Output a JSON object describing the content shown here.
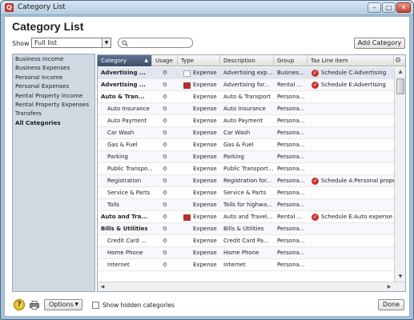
{
  "window": {
    "title": "Category List",
    "app_icon": "Q",
    "controls": {
      "minimize": "–",
      "maximize": "□",
      "close": "✕"
    }
  },
  "page": {
    "heading": "Category List"
  },
  "toolbar": {
    "show_label": "Show",
    "show_value": "Full list",
    "search_placeholder": "",
    "add_category_label": "Add Category"
  },
  "sidebar": {
    "items": [
      {
        "label": "Business Income",
        "selected": false
      },
      {
        "label": "Business Expenses",
        "selected": false
      },
      {
        "label": "Personal Income",
        "selected": false
      },
      {
        "label": "Personal Expenses",
        "selected": false
      },
      {
        "label": "Rental Property Income",
        "selected": false
      },
      {
        "label": "Rental Property Expenses",
        "selected": false
      },
      {
        "label": "Transfers",
        "selected": false
      },
      {
        "label": "All Categories",
        "selected": true
      }
    ]
  },
  "table": {
    "columns": [
      "Category",
      "Usage",
      "Type",
      "Description",
      "Group",
      "Tax Line Item"
    ],
    "sorted_column": "Category",
    "rows": [
      {
        "category": "Advertising ...",
        "usage": "0",
        "type": "Expense",
        "type_icon": "plain",
        "description": "Advertising exp...",
        "group": "Busines...",
        "tax": "Schedule C:Advertising",
        "bold": true,
        "selected": true
      },
      {
        "category": "Advertising ...",
        "usage": "0",
        "type": "Expense",
        "type_icon": "house",
        "description": "Advertising for...",
        "group": "Rental ...",
        "tax": "Schedule E:Advertising",
        "bold": true
      },
      {
        "category": "Auto & Tran...",
        "usage": "0",
        "type": "Expense",
        "type_icon": "",
        "description": "Auto & Transport",
        "group": "Persona...",
        "tax": "",
        "bold": true
      },
      {
        "category": "Auto Insurance",
        "usage": "0",
        "type": "Expense",
        "type_icon": "",
        "description": "Auto Insurance",
        "group": "Persona...",
        "tax": "",
        "indent": true
      },
      {
        "category": "Auto Payment",
        "usage": "0",
        "type": "Expense",
        "type_icon": "",
        "description": "Auto Payment",
        "group": "Persona...",
        "tax": "",
        "indent": true
      },
      {
        "category": "Car Wash",
        "usage": "0",
        "type": "Expense",
        "type_icon": "",
        "description": "Car Wash",
        "group": "Persona...",
        "tax": "",
        "indent": true
      },
      {
        "category": "Gas & Fuel",
        "usage": "0",
        "type": "Expense",
        "type_icon": "",
        "description": "Gas & Fuel",
        "group": "Persona...",
        "tax": "",
        "indent": true
      },
      {
        "category": "Parking",
        "usage": "0",
        "type": "Expense",
        "type_icon": "",
        "description": "Parking",
        "group": "Persona...",
        "tax": "",
        "indent": true
      },
      {
        "category": "Public Transpo...",
        "usage": "0",
        "type": "Expense",
        "type_icon": "",
        "description": "Public Transport...",
        "group": "Persona...",
        "tax": "",
        "indent": true
      },
      {
        "category": "Registration",
        "usage": "0",
        "type": "Expense",
        "type_icon": "",
        "description": "Registration for...",
        "group": "Persona...",
        "tax": "Schedule A:Personal property...",
        "indent": true
      },
      {
        "category": "Service & Parts",
        "usage": "0",
        "type": "Expense",
        "type_icon": "",
        "description": "Service & Parts",
        "group": "Persona...",
        "tax": "",
        "indent": true
      },
      {
        "category": "Tolls",
        "usage": "0",
        "type": "Expense",
        "type_icon": "",
        "description": "Tolls for highwa...",
        "group": "Persona...",
        "tax": "",
        "indent": true
      },
      {
        "category": "Auto and Tra...",
        "usage": "0",
        "type": "Expense",
        "type_icon": "house",
        "description": "Auto and Travel...",
        "group": "Rental ...",
        "tax": "Schedule E:Auto expense",
        "bold": true
      },
      {
        "category": "Bills & Utilities",
        "usage": "0",
        "type": "Expense",
        "type_icon": "",
        "description": "Bills & Utilities",
        "group": "Persona...",
        "tax": "",
        "bold": true
      },
      {
        "category": "Credit Card ...",
        "usage": "0",
        "type": "Expense",
        "type_icon": "",
        "description": "Credit Card Pa...",
        "group": "Persona...",
        "tax": "",
        "indent": true
      },
      {
        "category": "Home Phone",
        "usage": "0",
        "type": "Expense",
        "type_icon": "",
        "description": "Home Phone",
        "group": "Persona...",
        "tax": "",
        "indent": true
      },
      {
        "category": "Internet",
        "usage": "0",
        "type": "Expense",
        "type_icon": "",
        "description": "Internet",
        "group": "Persona...",
        "tax": "",
        "indent": true
      }
    ]
  },
  "footer": {
    "help_glyph": "?",
    "options_label": "Options",
    "show_hidden_label": "Show hidden categories",
    "done_label": "Done"
  },
  "colors": {
    "accent": "#b5302a",
    "sidebar_bg": "#d0d8e2",
    "window_frame": "#a8c0d8",
    "sorted_header": "#4a5a78"
  }
}
